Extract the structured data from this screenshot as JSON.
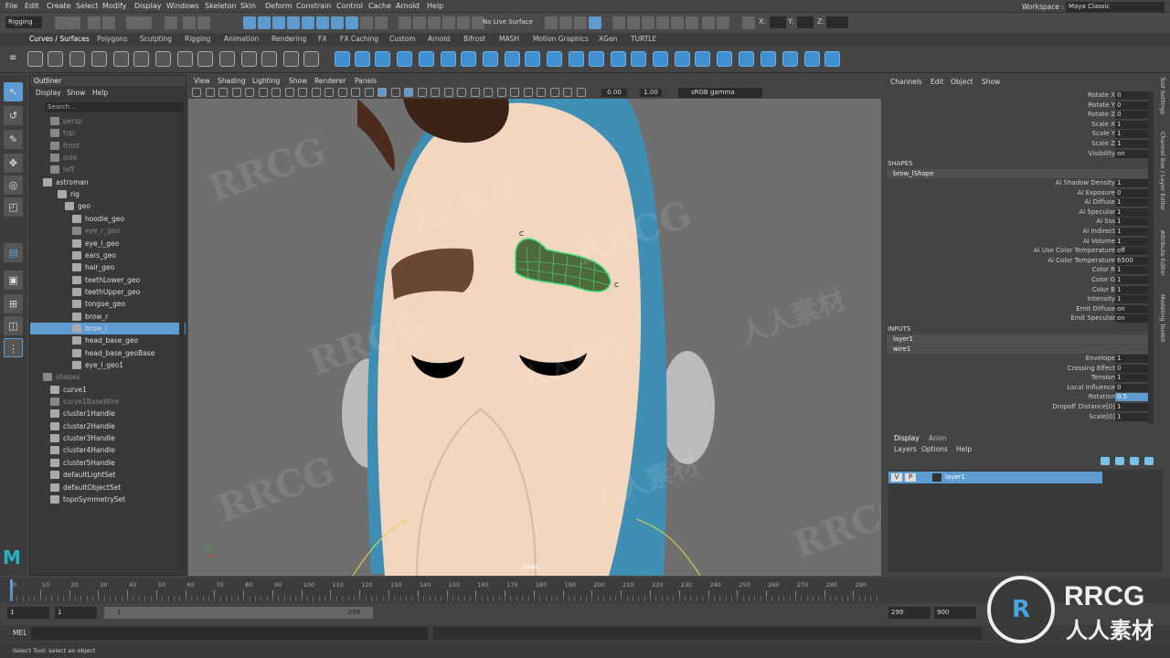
{
  "menu": {
    "items": [
      "File",
      "Edit",
      "Create",
      "Select",
      "Modify",
      "Display",
      "Windows",
      "Skeleton",
      "Skin",
      "Deform",
      "Constrain",
      "Control",
      "Cache",
      "Arnold",
      "Help"
    ],
    "workspace_label": "Workspace :",
    "workspace_value": "Maya Classic"
  },
  "toolbar": {
    "mode_value": "Rigging",
    "live_surface": "No Live Surface",
    "x_label": "X:",
    "y_label": "Y:",
    "z_label": "Z:"
  },
  "shelf": {
    "tabs": [
      "Curves / Surfaces",
      "Polygons",
      "Sculpting",
      "Rigging",
      "Animation",
      "Rendering",
      "FX",
      "FX Caching",
      "Custom",
      "Arnold",
      "Bifrost",
      "MASH",
      "Motion Graphics",
      "XGen",
      "TURTLE"
    ]
  },
  "outliner": {
    "title": "Outliner",
    "menu": [
      "Display",
      "Show",
      "Help"
    ],
    "search_placeholder": "Search...",
    "items": [
      {
        "label": "persp",
        "dim": true
      },
      {
        "label": "top",
        "dim": true
      },
      {
        "label": "front",
        "dim": true
      },
      {
        "label": "side",
        "dim": true
      },
      {
        "label": "left",
        "dim": true
      },
      {
        "label": "astroman",
        "dim": false
      },
      {
        "label": "rig",
        "dim": false
      },
      {
        "label": "geo",
        "dim": false
      },
      {
        "label": "hoodie_geo",
        "dim": false
      },
      {
        "label": "eye_r_geo",
        "dim": true
      },
      {
        "label": "eye_l_geo",
        "dim": false
      },
      {
        "label": "ears_geo",
        "dim": false
      },
      {
        "label": "hair_geo",
        "dim": false
      },
      {
        "label": "teethLower_geo",
        "dim": false
      },
      {
        "label": "teethUpper_geo",
        "dim": false
      },
      {
        "label": "tongue_geo",
        "dim": false
      },
      {
        "label": "brow_r",
        "dim": false
      },
      {
        "label": "brow_l",
        "dim": false
      },
      {
        "label": "head_base_geo",
        "dim": false
      },
      {
        "label": "head_base_geoBase",
        "dim": false
      },
      {
        "label": "eye_l_geo1",
        "dim": false
      },
      {
        "label": "shapes",
        "dim": true
      },
      {
        "label": "curve1",
        "dim": false
      },
      {
        "label": "curve1BaseWire",
        "dim": true
      },
      {
        "label": "cluster1Handle",
        "dim": false
      },
      {
        "label": "cluster2Handle",
        "dim": false
      },
      {
        "label": "cluster3Handle",
        "dim": false
      },
      {
        "label": "cluster4Handle",
        "dim": false
      },
      {
        "label": "cluster5Handle",
        "dim": false
      },
      {
        "label": "defaultLightSet",
        "dim": false
      },
      {
        "label": "defaultObjectSet",
        "dim": false
      },
      {
        "label": "topoSymmetrySet",
        "dim": false
      }
    ],
    "selected_index": 17
  },
  "viewport": {
    "menu": [
      "View",
      "Shading",
      "Lighting",
      "Show",
      "Renderer",
      "Panels"
    ],
    "field1": "0.00",
    "field2": "1.00",
    "colorspace": "sRGB gamma",
    "camera_label": "persp"
  },
  "channelbox": {
    "menu": [
      "Channels",
      "Edit",
      "Object",
      "Show"
    ],
    "transform": [
      {
        "name": "Rotate X",
        "value": "0"
      },
      {
        "name": "Rotate Y",
        "value": "0"
      },
      {
        "name": "Rotate Z",
        "value": "0"
      },
      {
        "name": "Scale X",
        "value": "1"
      },
      {
        "name": "Scale Y",
        "value": "1"
      },
      {
        "name": "Scale Z",
        "value": "1"
      },
      {
        "name": "Visibility",
        "value": "on"
      }
    ],
    "shapes_header": "SHAPES",
    "shape_name": "brow_lShape",
    "shape_attrs": [
      {
        "name": "Ai Shadow Density",
        "value": "1"
      },
      {
        "name": "Ai Exposure",
        "value": "0"
      },
      {
        "name": "Ai Diffuse",
        "value": "1"
      },
      {
        "name": "Ai Specular",
        "value": "1"
      },
      {
        "name": "Ai Sss",
        "value": "1"
      },
      {
        "name": "Ai Indirect",
        "value": "1"
      },
      {
        "name": "Ai Volume",
        "value": "1"
      },
      {
        "name": "Ai Use Color Temperature",
        "value": "off"
      },
      {
        "name": "Ai Color Temperature",
        "value": "6500"
      },
      {
        "name": "Color R",
        "value": "1"
      },
      {
        "name": "Color G",
        "value": "1"
      },
      {
        "name": "Color B",
        "value": "1"
      },
      {
        "name": "Intensity",
        "value": "1"
      },
      {
        "name": "Emit Diffuse",
        "value": "on"
      },
      {
        "name": "Emit Specular",
        "value": "on"
      }
    ],
    "inputs_header": "INPUTS",
    "inputs": [
      "layer1",
      "wire1"
    ],
    "wire_attrs": [
      {
        "name": "Envelope",
        "value": "1"
      },
      {
        "name": "Crossing Effect",
        "value": "0"
      },
      {
        "name": "Tension",
        "value": "1"
      },
      {
        "name": "Local Influence",
        "value": "0"
      },
      {
        "name": "Rotation",
        "value": "0.5"
      },
      {
        "name": "Dropoff Distance[0]",
        "value": "1"
      },
      {
        "name": "Scale[0]",
        "value": "1"
      }
    ],
    "side_tabs": [
      "Channel Box / Layer Editor",
      "Attribute Editor",
      "Modeling Toolkit",
      "Tool Settings"
    ]
  },
  "layers": {
    "tabs": [
      "Display",
      "Anim"
    ],
    "menu": [
      "Layers",
      "Options",
      "Help"
    ],
    "layer_v": "V",
    "layer_p": "P",
    "layer_name": "layer1"
  },
  "timeline": {
    "ticks": [
      "0",
      "10",
      "20",
      "30",
      "40",
      "50",
      "60",
      "70",
      "80",
      "90",
      "100",
      "110",
      "120",
      "130",
      "140",
      "150",
      "160",
      "170",
      "180",
      "190",
      "200",
      "210",
      "220",
      "230",
      "240",
      "250",
      "260",
      "270",
      "280",
      "290"
    ],
    "start": "1",
    "current": "1",
    "range_start": "1",
    "range_end": "299",
    "end": "299",
    "end2": "900"
  },
  "mel": {
    "label": "MEL"
  },
  "help": {
    "text": "Select Tool: select an object"
  },
  "watermark": {
    "text1": "RRCG",
    "text2": "人人素材"
  },
  "colors": {
    "selection": "#5d9bd0",
    "accent": "#4a9ad6",
    "skin": "#f2d6bf",
    "hood": "#3e8fb3",
    "brow": "#6b4632",
    "wire_green": "#3fe07a"
  }
}
